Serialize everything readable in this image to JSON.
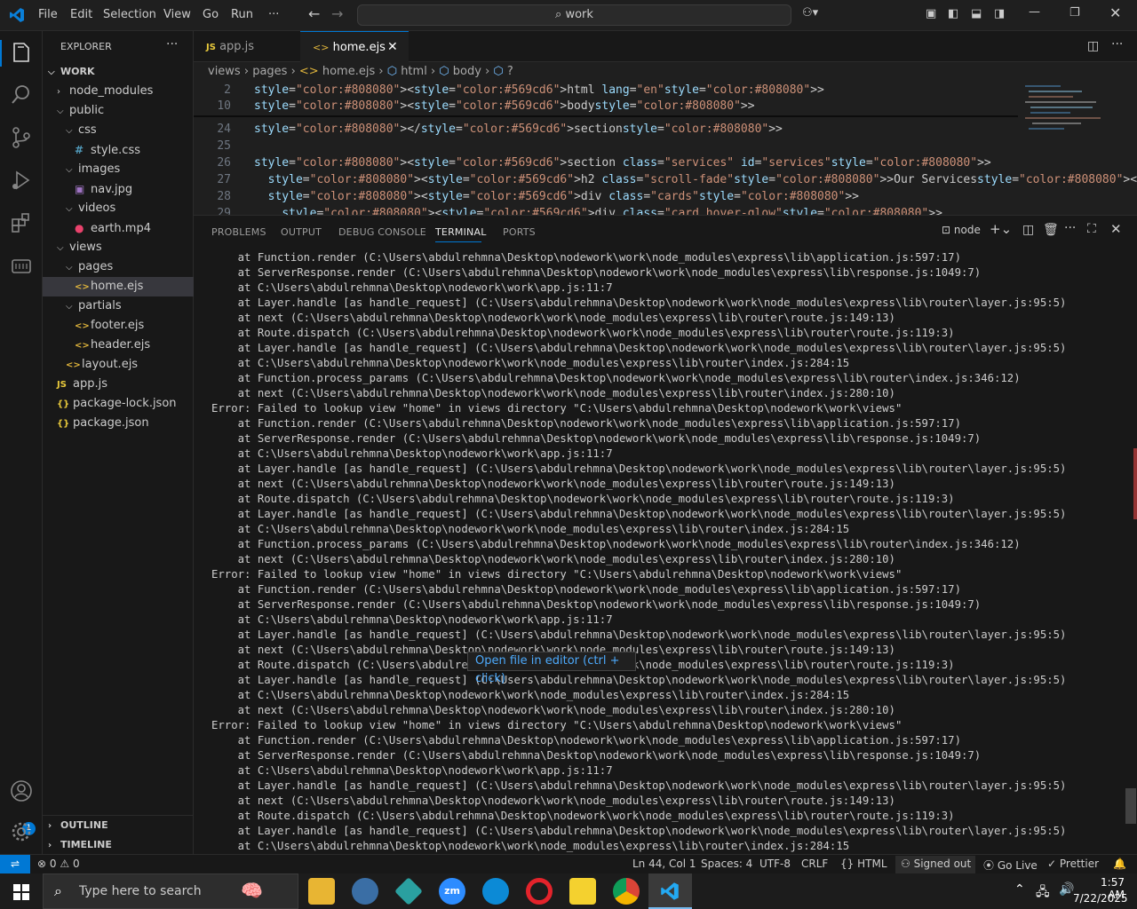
{
  "menu": [
    "File",
    "Edit",
    "Selection",
    "View",
    "Go",
    "Run",
    "···"
  ],
  "search": {
    "text": "work"
  },
  "explorer": {
    "title": "EXPLORER",
    "more": "···",
    "root": "WORK",
    "items": [
      {
        "label": "node_modules",
        "indent": 1,
        "type": "folder",
        "open": false
      },
      {
        "label": "public",
        "indent": 1,
        "type": "folder",
        "open": true
      },
      {
        "label": "css",
        "indent": 2,
        "type": "folder",
        "open": true
      },
      {
        "label": "style.css",
        "indent": 3,
        "type": "css"
      },
      {
        "label": "images",
        "indent": 2,
        "type": "folder",
        "open": true
      },
      {
        "label": "nav.jpg",
        "indent": 3,
        "type": "img"
      },
      {
        "label": "videos",
        "indent": 2,
        "type": "folder",
        "open": true
      },
      {
        "label": "earth.mp4",
        "indent": 3,
        "type": "video"
      },
      {
        "label": "views",
        "indent": 1,
        "type": "folder",
        "open": true
      },
      {
        "label": "pages",
        "indent": 2,
        "type": "folder",
        "open": true
      },
      {
        "label": "home.ejs",
        "indent": 3,
        "type": "ejs",
        "selected": true
      },
      {
        "label": "partials",
        "indent": 2,
        "type": "folder",
        "open": true
      },
      {
        "label": "footer.ejs",
        "indent": 3,
        "type": "ejs"
      },
      {
        "label": "header.ejs",
        "indent": 3,
        "type": "ejs"
      },
      {
        "label": "layout.ejs",
        "indent": 2,
        "type": "ejs"
      },
      {
        "label": "app.js",
        "indent": 1,
        "type": "js"
      },
      {
        "label": "package-lock.json",
        "indent": 1,
        "type": "json"
      },
      {
        "label": "package.json",
        "indent": 1,
        "type": "json"
      }
    ],
    "outline": "OUTLINE",
    "timeline": "TIMELINE"
  },
  "tabs": [
    {
      "label": "app.js",
      "icon": "JS",
      "active": false
    },
    {
      "label": "home.ejs",
      "icon": "<>",
      "active": true
    }
  ],
  "breadcrumb": [
    "views",
    "pages",
    "home.ejs",
    "html",
    "body",
    "?"
  ],
  "editor": {
    "lines": [
      {
        "n": "2",
        "code": "<html lang=\"en\">"
      },
      {
        "n": "10",
        "code": "<body>"
      },
      {
        "n": "24",
        "code": "</section>"
      },
      {
        "n": "25",
        "code": ""
      },
      {
        "n": "26",
        "code": "<section class=\"services\" id=\"services\">"
      },
      {
        "n": "27",
        "code": "  <h2 class=\"scroll-fade\">Our Services</h2>"
      },
      {
        "n": "28",
        "code": "  <div class=\"cards\">"
      },
      {
        "n": "29",
        "code": "    <div class=\"card hover-glow\">"
      }
    ]
  },
  "panel": {
    "tabs": [
      "PROBLEMS",
      "OUTPUT",
      "DEBUG CONSOLE",
      "TERMINAL",
      "PORTS"
    ],
    "active": "TERMINAL",
    "terminal_name": "node"
  },
  "terminal": [
    "    at Function.render (C:\\Users\\abdulrehmna\\Desktop\\nodework\\work\\node_modules\\express\\lib\\application.js:597:17)",
    "    at ServerResponse.render (C:\\Users\\abdulrehmna\\Desktop\\nodework\\work\\node_modules\\express\\lib\\response.js:1049:7)",
    "    at C:\\Users\\abdulrehmna\\Desktop\\nodework\\work\\app.js:11:7",
    "    at Layer.handle [as handle_request] (C:\\Users\\abdulrehmna\\Desktop\\nodework\\work\\node_modules\\express\\lib\\router\\layer.js:95:5)",
    "    at next (C:\\Users\\abdulrehmna\\Desktop\\nodework\\work\\node_modules\\express\\lib\\router\\route.js:149:13)",
    "    at Route.dispatch (C:\\Users\\abdulrehmna\\Desktop\\nodework\\work\\node_modules\\express\\lib\\router\\route.js:119:3)",
    "    at Layer.handle [as handle_request] (C:\\Users\\abdulrehmna\\Desktop\\nodework\\work\\node_modules\\express\\lib\\router\\layer.js:95:5)",
    "    at C:\\Users\\abdulrehmna\\Desktop\\nodework\\work\\node_modules\\express\\lib\\router\\index.js:284:15",
    "    at Function.process_params (C:\\Users\\abdulrehmna\\Desktop\\nodework\\work\\node_modules\\express\\lib\\router\\index.js:346:12)",
    "    at next (C:\\Users\\abdulrehmna\\Desktop\\nodework\\work\\node_modules\\express\\lib\\router\\index.js:280:10)",
    "Error: Failed to lookup view \"home\" in views directory \"C:\\Users\\abdulrehmna\\Desktop\\nodework\\work\\views\"",
    "    at Function.render (C:\\Users\\abdulrehmna\\Desktop\\nodework\\work\\node_modules\\express\\lib\\application.js:597:17)",
    "    at ServerResponse.render (C:\\Users\\abdulrehmna\\Desktop\\nodework\\work\\node_modules\\express\\lib\\response.js:1049:7)",
    "    at C:\\Users\\abdulrehmna\\Desktop\\nodework\\work\\app.js:11:7",
    "    at Layer.handle [as handle_request] (C:\\Users\\abdulrehmna\\Desktop\\nodework\\work\\node_modules\\express\\lib\\router\\layer.js:95:5)",
    "    at next (C:\\Users\\abdulrehmna\\Desktop\\nodework\\work\\node_modules\\express\\lib\\router\\route.js:149:13)",
    "    at Route.dispatch (C:\\Users\\abdulrehmna\\Desktop\\nodework\\work\\node_modules\\express\\lib\\router\\route.js:119:3)",
    "    at Layer.handle [as handle_request] (C:\\Users\\abdulrehmna\\Desktop\\nodework\\work\\node_modules\\express\\lib\\router\\layer.js:95:5)",
    "    at C:\\Users\\abdulrehmna\\Desktop\\nodework\\work\\node_modules\\express\\lib\\router\\index.js:284:15",
    "    at Function.process_params (C:\\Users\\abdulrehmna\\Desktop\\nodework\\work\\node_modules\\express\\lib\\router\\index.js:346:12)",
    "    at next (C:\\Users\\abdulrehmna\\Desktop\\nodework\\work\\node_modules\\express\\lib\\router\\index.js:280:10)",
    "Error: Failed to lookup view \"home\" in views directory \"C:\\Users\\abdulrehmna\\Desktop\\nodework\\work\\views\"",
    "    at Function.render (C:\\Users\\abdulrehmna\\Desktop\\nodework\\work\\node_modules\\express\\lib\\application.js:597:17)",
    "    at ServerResponse.render (C:\\Users\\abdulrehmna\\Desktop\\nodework\\work\\node_modules\\express\\lib\\response.js:1049:7)",
    "    at C:\\Users\\abdulrehmna\\Desktop\\nodework\\work\\app.js:11:7",
    "    at Layer.handle [as handle_request] (C:\\Users\\abdulrehmna\\Desktop\\nodework\\work\\node_modules\\express\\lib\\router\\layer.js:95:5)",
    "    at next (C:\\Users\\abdulrehmna\\Desktop\\nodework\\work\\node_modules\\express\\lib\\router\\route.js:149:13)",
    "    at Route.dispatch (C:\\Users\\abdulrehmna\\Desktop\\nodework\\work\\node_modules\\express\\lib\\router\\route.js:119:3)",
    "    at Layer.handle [as handle_request] (C:\\Users\\abdulrehmna\\Desktop\\nodework\\work\\node_modules\\express\\lib\\router\\layer.js:95:5)",
    "    at C:\\Users\\abdulrehmna\\Desktop\\nodework\\work\\node_modules\\express\\lib\\router\\index.js:284:15",
    "    at next (C:\\Users\\abdulrehmna\\Desktop\\nodework\\work\\node_modules\\express\\lib\\router\\index.js:280:10)",
    "Error: Failed to lookup view \"home\" in views directory \"C:\\Users\\abdulrehmna\\Desktop\\nodework\\work\\views\"",
    "    at Function.render (C:\\Users\\abdulrehmna\\Desktop\\nodework\\work\\node_modules\\express\\lib\\application.js:597:17)",
    "    at ServerResponse.render (C:\\Users\\abdulrehmna\\Desktop\\nodework\\work\\node_modules\\express\\lib\\response.js:1049:7)",
    "    at C:\\Users\\abdulrehmna\\Desktop\\nodework\\work\\app.js:11:7",
    "    at Layer.handle [as handle_request] (C:\\Users\\abdulrehmna\\Desktop\\nodework\\work\\node_modules\\express\\lib\\router\\layer.js:95:5)",
    "    at next (C:\\Users\\abdulrehmna\\Desktop\\nodework\\work\\node_modules\\express\\lib\\router\\route.js:149:13)",
    "    at Route.dispatch (C:\\Users\\abdulrehmna\\Desktop\\nodework\\work\\node_modules\\express\\lib\\router\\route.js:119:3)",
    "    at Layer.handle [as handle_request] (C:\\Users\\abdulrehmna\\Desktop\\nodework\\work\\node_modules\\express\\lib\\router\\layer.js:95:5)",
    "    at C:\\Users\\abdulrehmna\\Desktop\\nodework\\work\\node_modules\\express\\lib\\router\\index.js:284:15"
  ],
  "tooltip": "Open file in editor (ctrl + click)",
  "status": {
    "errors": "0",
    "warnings": "0",
    "position": "Ln 44, Col 1",
    "spaces": "Spaces: 4",
    "encoding": "UTF-8",
    "eol": "CRLF",
    "language": "HTML",
    "signed": "Signed out",
    "golive": "Go Live",
    "prettier": "Prettier"
  },
  "taskbar": {
    "search": "Type here to search",
    "time": "1:57 AM",
    "date": "7/22/2025"
  },
  "colors": {
    "accent": "#0078d4",
    "keyword": "#569cd6",
    "attr": "#9cdcfe",
    "string": "#ce9178",
    "tag": "#808080"
  }
}
